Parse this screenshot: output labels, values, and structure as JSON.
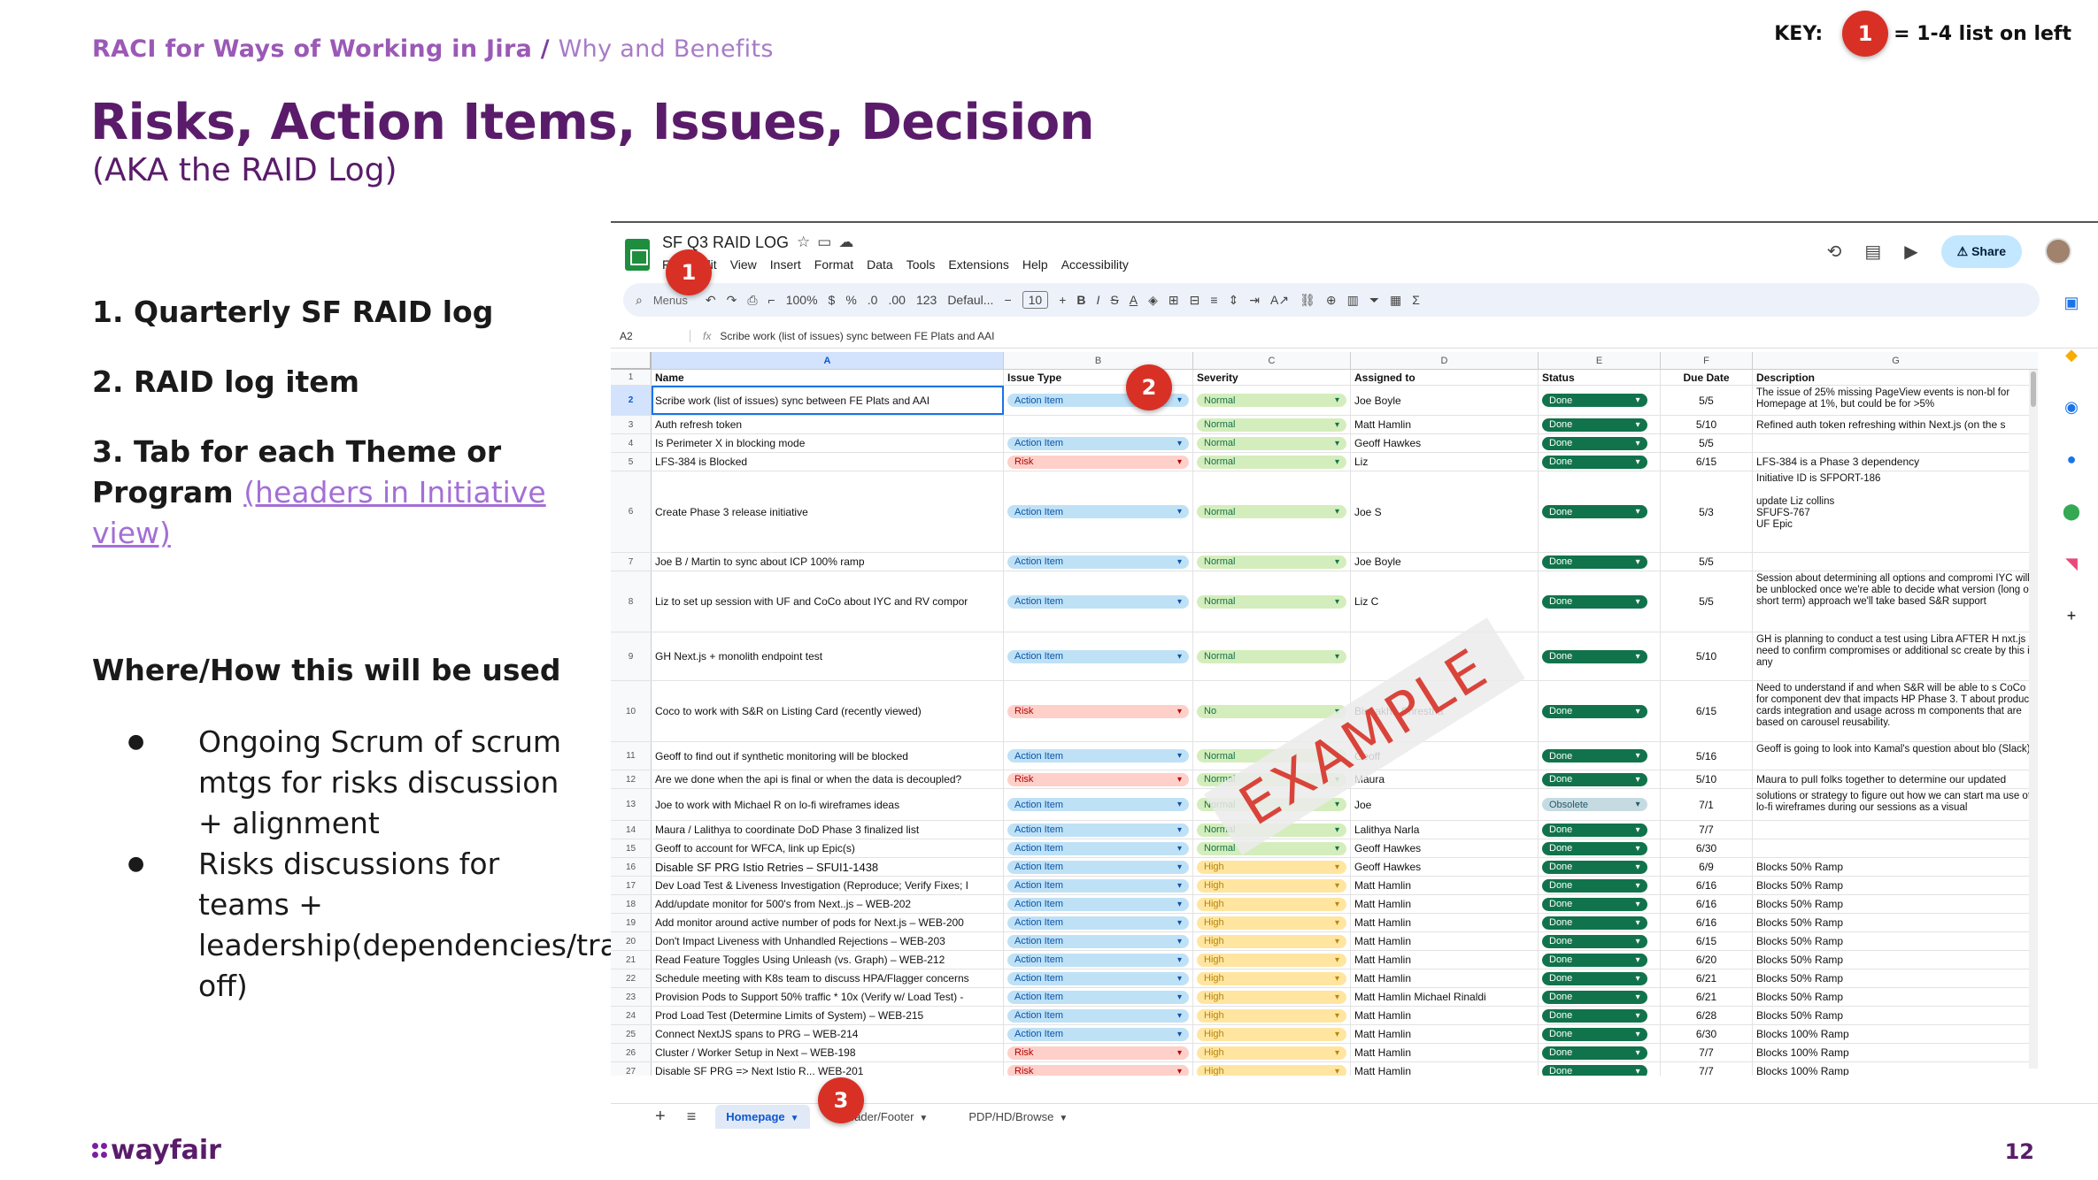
{
  "breadcrumb": {
    "main": "RACI for Ways of Working in Jira",
    "separator": "/",
    "sub": "Why and Benefits"
  },
  "key": {
    "label": "KEY:",
    "badge": "1",
    "text": "= 1-4 list on left"
  },
  "title": "Risks, Action Items, Issues, Decision",
  "subtitle": "(AKA the RAID Log)",
  "numbered_list": [
    {
      "text": "1. Quarterly SF RAID log"
    },
    {
      "text": "2. RAID log item"
    },
    {
      "text": "3. Tab for each Theme or Program",
      "link": "(headers in Initiative view)"
    }
  ],
  "where_heading": "Where/How this will be used",
  "bullets": [
    "Ongoing Scrum of scrum mtgs for risks discussion + alignment",
    "Risks discussions for teams + leadership(dependencies/trade off)"
  ],
  "logo_text": "wayfair",
  "page_number": "12",
  "badges": {
    "b1": "1",
    "b2": "2",
    "b3": "3"
  },
  "sheet": {
    "doc_title": "SF Q3 RAID LOG",
    "menu": [
      "File",
      "Edit",
      "View",
      "Insert",
      "Format",
      "Data",
      "Tools",
      "Extensions",
      "Help",
      "Accessibility"
    ],
    "share_label": "Share",
    "toolbar": {
      "menus": "Menus",
      "zoom": "100%",
      "currency": "$",
      "percent": "%",
      "dec": ".0",
      "dec2": ".00",
      "num": "123",
      "font": "Defaul...",
      "size": "10"
    },
    "cell_ref": "A2",
    "formula": "Scribe work (list of issues) sync between FE Plats and AAI",
    "columns": [
      "A",
      "B",
      "C",
      "D",
      "E",
      "F",
      "G"
    ],
    "headers": [
      "Name",
      "Issue Type",
      "Severity",
      "Assigned to",
      "Status",
      "Due Date",
      "Description"
    ],
    "rows": [
      {
        "n": "2",
        "name": "Scribe work (list of issues) sync between FE Plats and AAI",
        "type": "Action Item",
        "sev": "Normal",
        "who": "Joe Boyle",
        "status": "Done",
        "due": "5/5",
        "desc": "The issue of 25% missing PageView events is non-bl for Homepage at 1%, but could be for >5%"
      },
      {
        "n": "3",
        "name": "Auth refresh token",
        "type": "",
        "sev": "Normal",
        "who": "Matt Hamlin",
        "status": "Done",
        "due": "5/10",
        "desc": "Refined auth token refreshing within Next.js (on the s"
      },
      {
        "n": "4",
        "name": "Is Perimeter X in blocking mode",
        "type": "Action Item",
        "sev": "Normal",
        "who": "Geoff Hawkes",
        "status": "Done",
        "due": "5/5",
        "desc": ""
      },
      {
        "n": "5",
        "name": "LFS-384 is Blocked",
        "type": "Risk",
        "sev": "Normal",
        "who": "Liz",
        "status": "Done",
        "due": "6/15",
        "desc": "LFS-384 is a Phase 3 dependency"
      },
      {
        "n": "6",
        "name": "Create Phase 3 release initiative",
        "type": "Action Item",
        "sev": "Normal",
        "who": "Joe S",
        "status": "Done",
        "due": "5/3",
        "desc": "Initiative ID is SFPORT-186\n\nupdate Liz collins\nSFUFS-767\nUF Epic"
      },
      {
        "n": "7",
        "name": "Joe B / Martin to sync about ICP 100% ramp",
        "type": "Action Item",
        "sev": "Normal",
        "who": "Joe Boyle",
        "status": "Done",
        "due": "5/5",
        "desc": ""
      },
      {
        "n": "8",
        "name": "Liz to set up session with UF and CoCo about IYC and RV compor",
        "type": "Action Item",
        "sev": "Normal",
        "who": "Liz C",
        "status": "Done",
        "due": "5/5",
        "desc": "Session about determining  all options and compromi IYC will be unblocked once we're able to decide what version (long or short term) approach we'll take based S&R support"
      },
      {
        "n": "9",
        "name": "GH Next.js + monolith endpoint test",
        "type": "Action Item",
        "sev": "Normal",
        "who": "",
        "status": "Done",
        "due": "5/10",
        "desc": "GH is planning to conduct a test using Libra AFTER H nxt.js - need to confirm compromises or additional sc create by this if any"
      },
      {
        "n": "10",
        "name": "Coco to work with S&R on Listing Card (recently viewed)",
        "type": "Risk",
        "sev": "No",
        "who": "Bishakha Shrestha",
        "status": "Done",
        "due": "6/15",
        "desc": "Need to understand if and when S&R will be able to s CoCo for component dev that impacts HP Phase 3.  T about product cards integration and usage across m components that are based on carousel reusability."
      },
      {
        "n": "11",
        "name": "Geoff to find out if synthetic monitoring will be blocked",
        "type": "Action Item",
        "sev": "Normal",
        "who": "Geoff",
        "status": "Done",
        "due": "5/16",
        "desc": "Geoff is going to look into Kamal's question about blo (Slack)"
      },
      {
        "n": "12",
        "name": "Are we done when the api is final or when the data is decoupled?",
        "type": "Risk",
        "sev": "Normal",
        "who": "Maura",
        "status": "Done",
        "due": "5/10",
        "desc": "Maura to pull folks together to determine our updated"
      },
      {
        "n": "13",
        "name": "Joe to work with Michael R on lo-fi wireframes ideas",
        "type": "Action Item",
        "sev": "Normal",
        "who": "Joe",
        "status": "Obsolete",
        "due": "7/1",
        "desc": "solutions or strategy to figure out how we can start ma use of lo-fi wireframes during our sessions as a visual"
      },
      {
        "n": "14",
        "name": "Maura / Lalithya to coordinate DoD Phase 3 finalized list",
        "type": "Action Item",
        "sev": "Normal",
        "who": "Lalithya Narla",
        "status": "Done",
        "due": "7/7",
        "desc": ""
      },
      {
        "n": "15",
        "name": "Geoff to account for WFCA, link up Epic(s)",
        "type": "Action Item",
        "sev": "Normal",
        "who": "Geoff Hawkes",
        "status": "Done",
        "due": "6/30",
        "desc": ""
      },
      {
        "n": "16",
        "name": "Disable SF PRG Istio Retries – SFUI1-1438",
        "type": "Action Item",
        "sev": "High",
        "who": "Geoff Hawkes",
        "status": "Done",
        "due": "6/9",
        "desc": "Blocks 50% Ramp"
      },
      {
        "n": "17",
        "name": "Dev Load Test & Liveness Investigation (Reproduce; Verify Fixes; I",
        "type": "Action Item",
        "sev": "High",
        "who": "Matt Hamlin",
        "status": "Done",
        "due": "6/16",
        "desc": "Blocks 50% Ramp"
      },
      {
        "n": "18",
        "name": "Add/update monitor for 500's from Next..js – WEB-202",
        "type": "Action Item",
        "sev": "High",
        "who": "Matt Hamlin",
        "status": "Done",
        "due": "6/16",
        "desc": "Blocks 50% Ramp"
      },
      {
        "n": "19",
        "name": "Add monitor around active number of pods for Next.js – WEB-200",
        "type": "Action Item",
        "sev": "High",
        "who": "Matt Hamlin",
        "status": "Done",
        "due": "6/16",
        "desc": "Blocks 50% Ramp"
      },
      {
        "n": "20",
        "name": "Don't Impact Liveness with Unhandled Rejections – WEB-203",
        "type": "Action Item",
        "sev": "High",
        "who": "Matt Hamlin",
        "status": "Done",
        "due": "6/15",
        "desc": "Blocks 50% Ramp"
      },
      {
        "n": "21",
        "name": "Read Feature Toggles Using Unleash (vs. Graph) – WEB-212",
        "type": "Action Item",
        "sev": "High",
        "who": "Matt Hamlin",
        "status": "Done",
        "due": "6/20",
        "desc": "Blocks 50% Ramp"
      },
      {
        "n": "22",
        "name": "Schedule meeting with K8s team to discuss HPA/Flagger concerns",
        "type": "Action Item",
        "sev": "High",
        "who": "Matt Hamlin",
        "status": "Done",
        "due": "6/21",
        "desc": "Blocks 50% Ramp"
      },
      {
        "n": "23",
        "name": "Provision Pods to Support 50% traffic * 10x (Verify w/ Load Test) -",
        "type": "Action Item",
        "sev": "High",
        "who": "Matt Hamlin  Michael Rinaldi",
        "status": "Done",
        "due": "6/21",
        "desc": "Blocks 50% Ramp"
      },
      {
        "n": "24",
        "name": "Prod Load Test (Determine Limits of System) – WEB-215",
        "type": "Action Item",
        "sev": "High",
        "who": "Matt Hamlin",
        "status": "Done",
        "due": "6/28",
        "desc": "Blocks 50% Ramp"
      },
      {
        "n": "25",
        "name": "Connect NextJS spans to PRG – WEB-214",
        "type": "Action Item",
        "sev": "High",
        "who": "Matt Hamlin",
        "status": "Done",
        "due": "6/30",
        "desc": "Blocks 100% Ramp"
      },
      {
        "n": "26",
        "name": "Cluster / Worker Setup in Next – WEB-198",
        "type": "Risk",
        "sev": "High",
        "who": "Matt Hamlin",
        "status": "Done",
        "due": "7/7",
        "desc": "Blocks 100% Ramp"
      },
      {
        "n": "27",
        "name": "Disable SF PRG => Next Istio R... WEB-201",
        "type": "Risk",
        "sev": "High",
        "who": "Matt Hamlin",
        "status": "Done",
        "due": "7/7",
        "desc": "Blocks 100% Ramp"
      }
    ],
    "stamp": "EXAMPLE",
    "tabs": [
      "Homepage",
      "Header/Footer",
      "PDP/HD/Browse"
    ]
  },
  "colors": {
    "brand_purple": "#5a1c6a",
    "badge_red": "#d93025",
    "done_green": "#11734b"
  }
}
